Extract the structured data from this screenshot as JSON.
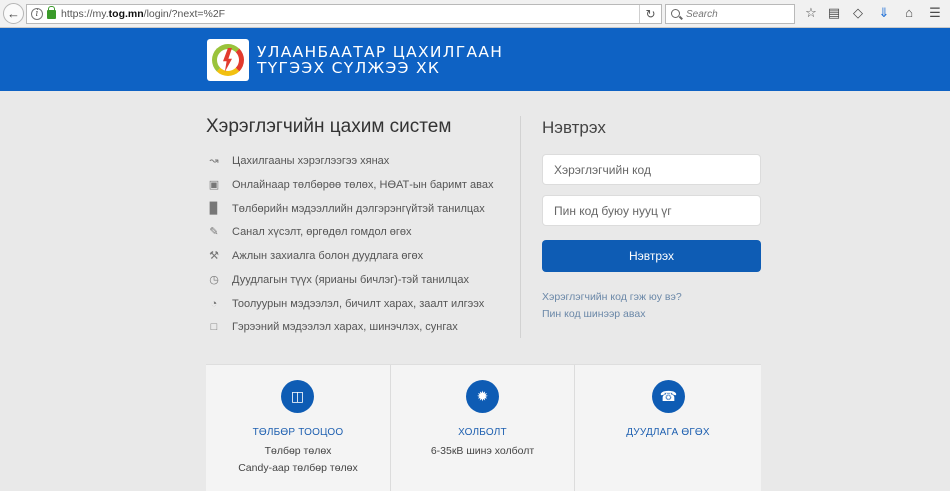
{
  "browser": {
    "url_prefix": "https://my.",
    "url_host": "tog.mn",
    "url_path": "/login/?next=%2F",
    "search_placeholder": "Search"
  },
  "header": {
    "company_line1": "УЛААНБААТАР ЦАХИЛГААН",
    "company_line2": "ТҮГЭЭХ СҮЛЖЭЭ ХК"
  },
  "features": {
    "title": "Хэрэглэгчийн цахим систем",
    "items": [
      {
        "icon": "chart-icon",
        "label": "Цахилгааны хэрэглээгээ хянах"
      },
      {
        "icon": "credit-card-icon",
        "label": "Онлайнаар төлбөрөө төлөх, НӨАТ-ын баримт авах"
      },
      {
        "icon": "bar-chart-icon",
        "label": "Төлбөрийн мэдээллийн дэлгэрэнгүйтэй танилцах"
      },
      {
        "icon": "pencil-icon",
        "label": "Санал хүсэлт, өргөдөл гомдол өгөх"
      },
      {
        "icon": "wrench-icon",
        "label": "Ажлын захиалга болон дуудлага өгөх"
      },
      {
        "icon": "clock-icon",
        "label": "Дуудлагын түүх (ярианы бичлэг)-тэй танилцах"
      },
      {
        "icon": "dashboard-icon",
        "label": "Тоолуурын мэдээлэл, бичилт харах, заалт илгээх"
      },
      {
        "icon": "book-icon",
        "label": "Гэрээний мэдээлэл харах, шинэчлэх, сунгах"
      }
    ]
  },
  "login": {
    "title": "Нэвтрэх",
    "user_placeholder": "Хэрэглэгчийн код",
    "pin_placeholder": "Пин код буюу нууц үг",
    "button": "Нэвтрэх",
    "link_forgot_code": "Хэрэглэгчийн код гэж юу вэ?",
    "link_renew_pin": "Пин код шинээр авах"
  },
  "cards": [
    {
      "title": "ТӨЛБӨР ТООЦОО",
      "lines": [
        "Төлбөр төлөх",
        "Candy-аар төлбөр төлөх"
      ],
      "icon": "payment-icon"
    },
    {
      "title": "ХОЛБОЛТ",
      "lines": [
        "6-35кВ шинэ холболт"
      ],
      "icon": "connection-icon"
    },
    {
      "title": "ДУУДЛАГА ӨГӨХ",
      "lines": [],
      "icon": "support-icon"
    }
  ],
  "colors": {
    "brand_blue": "#0e62c4",
    "button_blue": "#0e5cb4",
    "link": "#6b88a8"
  }
}
